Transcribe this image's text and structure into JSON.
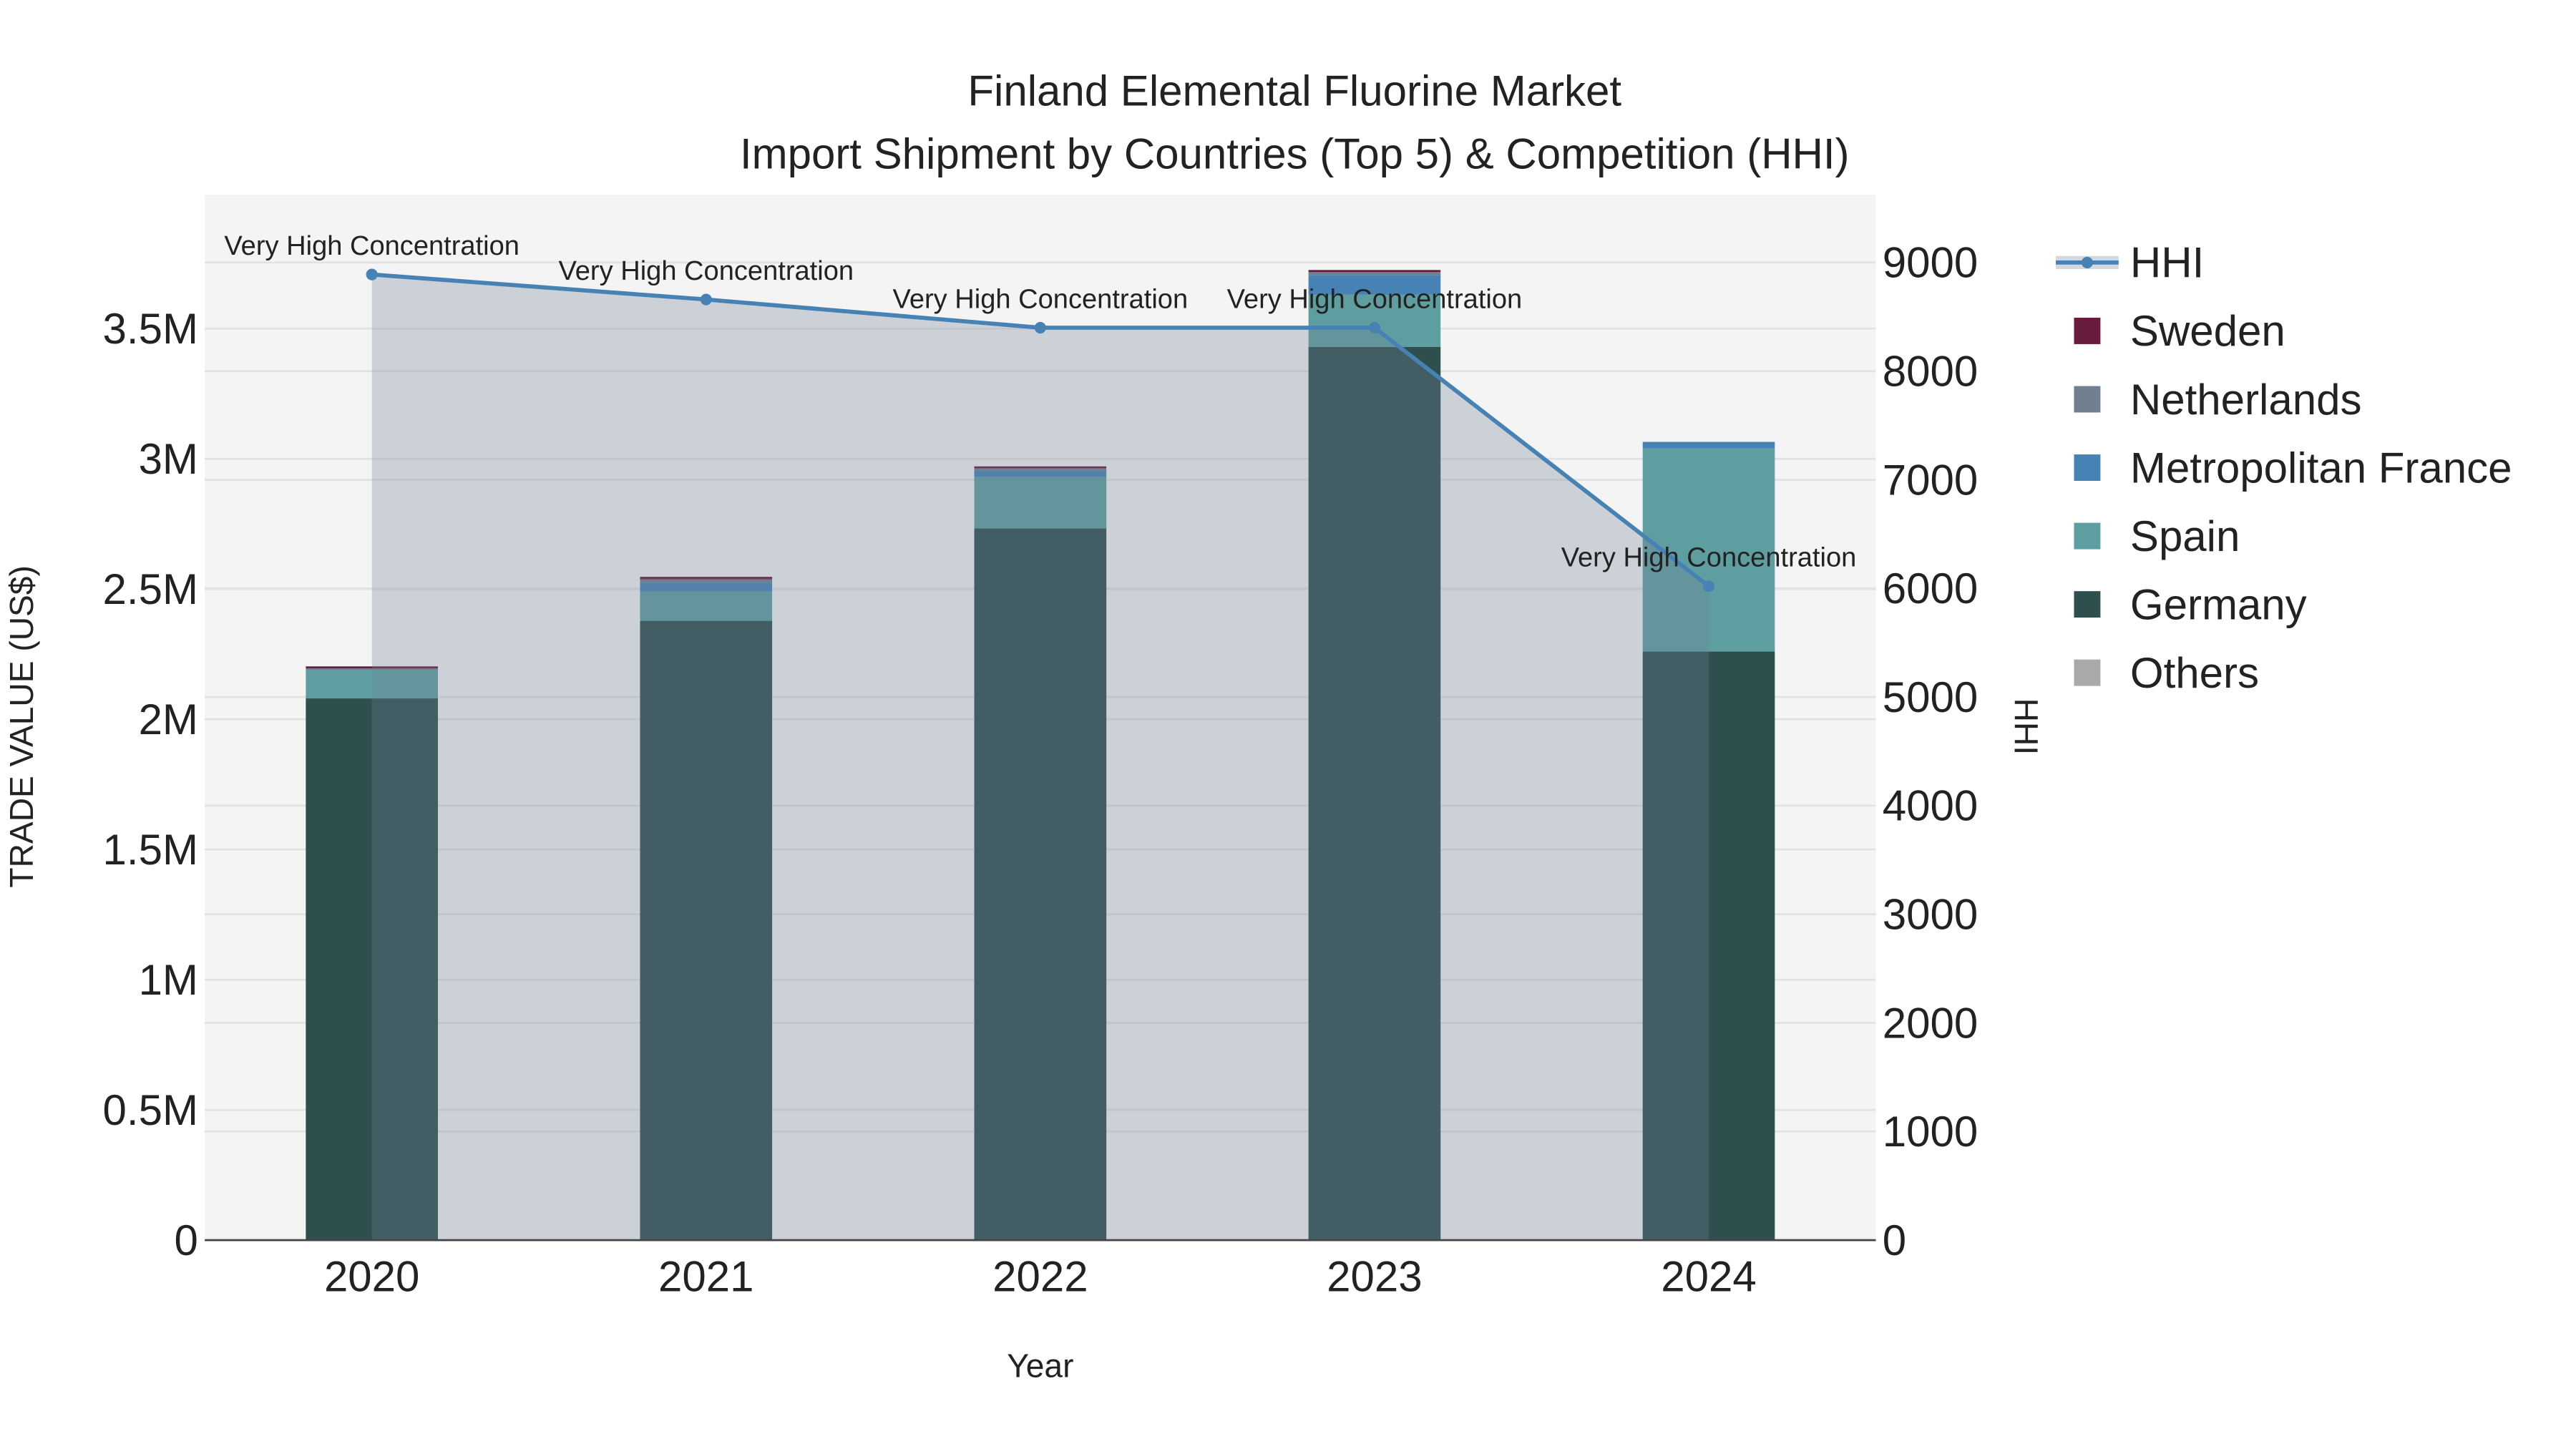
{
  "chart_data": {
    "type": "bar",
    "title_line1": "Finland Elemental Fluorine Market",
    "title_line2": "Import Shipment by Countries (Top 5) & Competition (HHI)",
    "xlabel": "Year",
    "ylabel": "TRADE VALUE (US$)",
    "y2label": "HHI",
    "categories": [
      "2020",
      "2021",
      "2022",
      "2023",
      "2024"
    ],
    "ylim": [
      0,
      3900000
    ],
    "y2lim": [
      0,
      9500
    ],
    "yticks": [
      0,
      500000,
      1000000,
      1500000,
      2000000,
      2500000,
      3000000,
      3500000
    ],
    "ytick_labels": [
      "0",
      "0.5M",
      "1M",
      "1.5M",
      "2M",
      "2.5M",
      "3M",
      "3.5M"
    ],
    "y2ticks": [
      0,
      1000,
      2000,
      3000,
      4000,
      5000,
      6000,
      7000,
      8000,
      9000
    ],
    "y2tick_labels": [
      "0",
      "1000",
      "2000",
      "3000",
      "4000",
      "5000",
      "6000",
      "7000",
      "8000",
      "9000"
    ],
    "series": [
      {
        "name": "Germany",
        "color": "#2f4f4f",
        "values": [
          2080000,
          2378000,
          2733000,
          3430000,
          2260000
        ]
      },
      {
        "name": "Spain",
        "color": "#5f9ea0",
        "values": [
          110000,
          112000,
          197000,
          200000,
          780000
        ]
      },
      {
        "name": "Metropolitan France",
        "color": "#4682b4",
        "values": [
          0,
          35000,
          25000,
          75000,
          25000
        ]
      },
      {
        "name": "Netherlands",
        "color": "#708090",
        "values": [
          5000,
          12000,
          8000,
          12000,
          0
        ]
      },
      {
        "name": "Sweden",
        "color": "#6b1a3f",
        "values": [
          8000,
          10000,
          8000,
          8000,
          0
        ]
      },
      {
        "name": "Others",
        "color": "#a9a9a9",
        "values": [
          0,
          0,
          0,
          0,
          0
        ]
      }
    ],
    "hhi": {
      "name": "HHI",
      "color": "#4682b4",
      "values": [
        8890,
        8660,
        8400,
        8400,
        6020
      ],
      "annotations": [
        "Very High Concentration",
        "Very High Concentration",
        "Very High Concentration",
        "Very High Concentration",
        "Very High Concentration"
      ]
    },
    "legend": [
      "HHI",
      "Sweden",
      "Netherlands",
      "Metropolitan France",
      "Spain",
      "Germany",
      "Others"
    ],
    "legend_placement": "right",
    "grid": true
  }
}
